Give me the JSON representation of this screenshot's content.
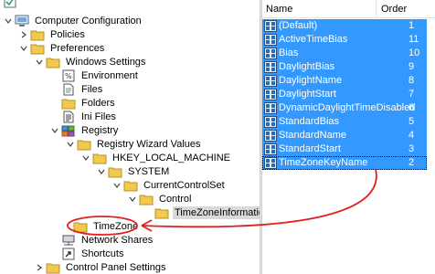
{
  "tree": {
    "items": [
      {
        "label": "",
        "icon": "checkbox-icon",
        "expander": "none"
      },
      {
        "label": "Computer Configuration",
        "icon": "computer-icon",
        "expander": "expanded"
      },
      {
        "label": "Policies",
        "icon": "folder-icon",
        "expander": "collapsed"
      },
      {
        "label": "Preferences",
        "icon": "folder-icon",
        "expander": "expanded"
      },
      {
        "label": "Windows Settings",
        "icon": "folder-icon",
        "expander": "expanded"
      },
      {
        "label": "Environment",
        "icon": "environment-icon",
        "expander": "none"
      },
      {
        "label": "Files",
        "icon": "file-icon",
        "expander": "none"
      },
      {
        "label": "Folders",
        "icon": "folder-icon",
        "expander": "none"
      },
      {
        "label": "Ini Files",
        "icon": "ini-file-icon",
        "expander": "none"
      },
      {
        "label": "Registry",
        "icon": "registry-icon",
        "expander": "expanded"
      },
      {
        "label": "Registry Wizard Values",
        "icon": "folder-icon",
        "expander": "expanded"
      },
      {
        "label": "HKEY_LOCAL_MACHINE",
        "icon": "folder-icon",
        "expander": "expanded"
      },
      {
        "label": "SYSTEM",
        "icon": "folder-icon",
        "expander": "expanded"
      },
      {
        "label": "CurrentControlSet",
        "icon": "folder-icon",
        "expander": "expanded"
      },
      {
        "label": "Control",
        "icon": "folder-icon",
        "expander": "expanded"
      },
      {
        "label": "TimeZoneInformation",
        "icon": "folder-icon",
        "expander": "none"
      },
      {
        "label": "TimeZone",
        "icon": "folder-icon",
        "expander": "none"
      },
      {
        "label": "Network Shares",
        "icon": "network-shares-icon",
        "expander": "none"
      },
      {
        "label": "Shortcuts",
        "icon": "shortcut-icon",
        "expander": "none"
      },
      {
        "label": "Control Panel Settings",
        "icon": "folder-icon",
        "expander": "collapsed"
      }
    ]
  },
  "list": {
    "headers": {
      "name": "Name",
      "order": "Order"
    },
    "rows": [
      {
        "name": "(Default)",
        "order": "1"
      },
      {
        "name": "ActiveTimeBias",
        "order": "11"
      },
      {
        "name": "Bias",
        "order": "10"
      },
      {
        "name": "DaylightBias",
        "order": "9"
      },
      {
        "name": "DaylightName",
        "order": "8"
      },
      {
        "name": "DaylightStart",
        "order": "7"
      },
      {
        "name": "DynamicDaylightTimeDisabled",
        "order": "6"
      },
      {
        "name": "StandardBias",
        "order": "5"
      },
      {
        "name": "StandardName",
        "order": "4"
      },
      {
        "name": "StandardStart",
        "order": "3"
      },
      {
        "name": "TimeZoneKeyName",
        "order": "2"
      }
    ],
    "row_icon": "registry-value-icon"
  },
  "colors": {
    "selection": "#3399ff",
    "annotation": "#e02020",
    "folder": "#f2c94c"
  }
}
